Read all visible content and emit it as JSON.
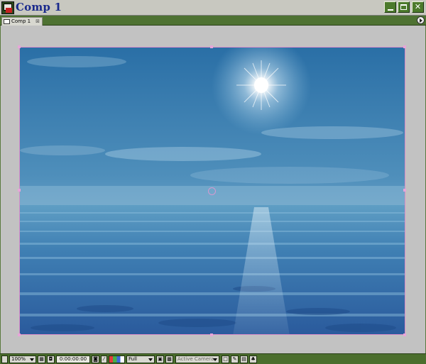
{
  "window": {
    "title": "Comp 1",
    "tab_label": "Comp 1"
  },
  "toolbar": {
    "magnification": "100%",
    "timecode": "0:00:00:00",
    "resolution": "Full",
    "camera_view": "Active Camera"
  },
  "icons": {
    "app": "after-effects-comp-icon",
    "minimize": "minimize-icon",
    "maximize": "maximize-icon",
    "close": "close-icon",
    "panel_menu": "panel-menu-arrow-icon"
  },
  "colors": {
    "frame_accent": "#5b7a3e",
    "title_text": "#1a2a8c",
    "viewer_bg": "#c2c2c2",
    "handle_color": "#e7a5d8"
  }
}
